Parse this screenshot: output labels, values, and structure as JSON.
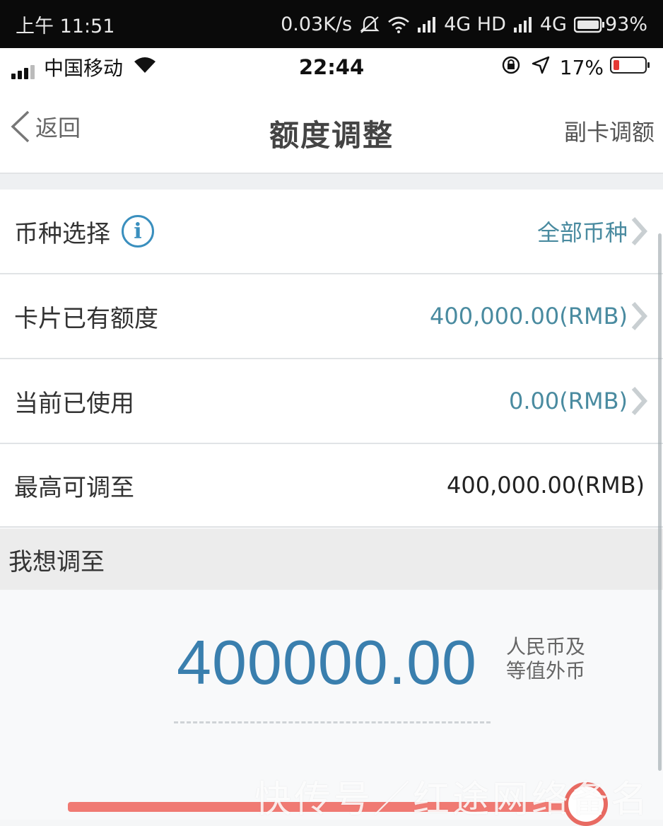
{
  "android_status": {
    "time": "上午 11:51",
    "speed": "0.03K/s",
    "net1": "4G HD",
    "net2": "4G",
    "battery": "93%"
  },
  "ios_status": {
    "carrier": "中国移动",
    "time": "22:44",
    "battery": "17%"
  },
  "nav": {
    "back_label": "返回",
    "title": "额度调整",
    "right_action": "副卡调额"
  },
  "rows": [
    {
      "label": "币种选择",
      "value": "全部币种"
    },
    {
      "label": "卡片已有额度",
      "value": "400,000.00(RMB)"
    },
    {
      "label": "当前已使用",
      "value": "0.00(RMB)"
    },
    {
      "label": "最高可调至",
      "value": "400,000.00(RMB)"
    }
  ],
  "adjust": {
    "section_title": "我想调至",
    "amount": "400000.00",
    "unit_line1": "人民币及",
    "unit_line2": "等值外币",
    "slider_fraction": 1.0
  },
  "watermark": "快传号／红途网络备名",
  "colors": {
    "accent": "#3a7fae",
    "value_text": "#4a8ba0",
    "slider": "#f07a73"
  }
}
